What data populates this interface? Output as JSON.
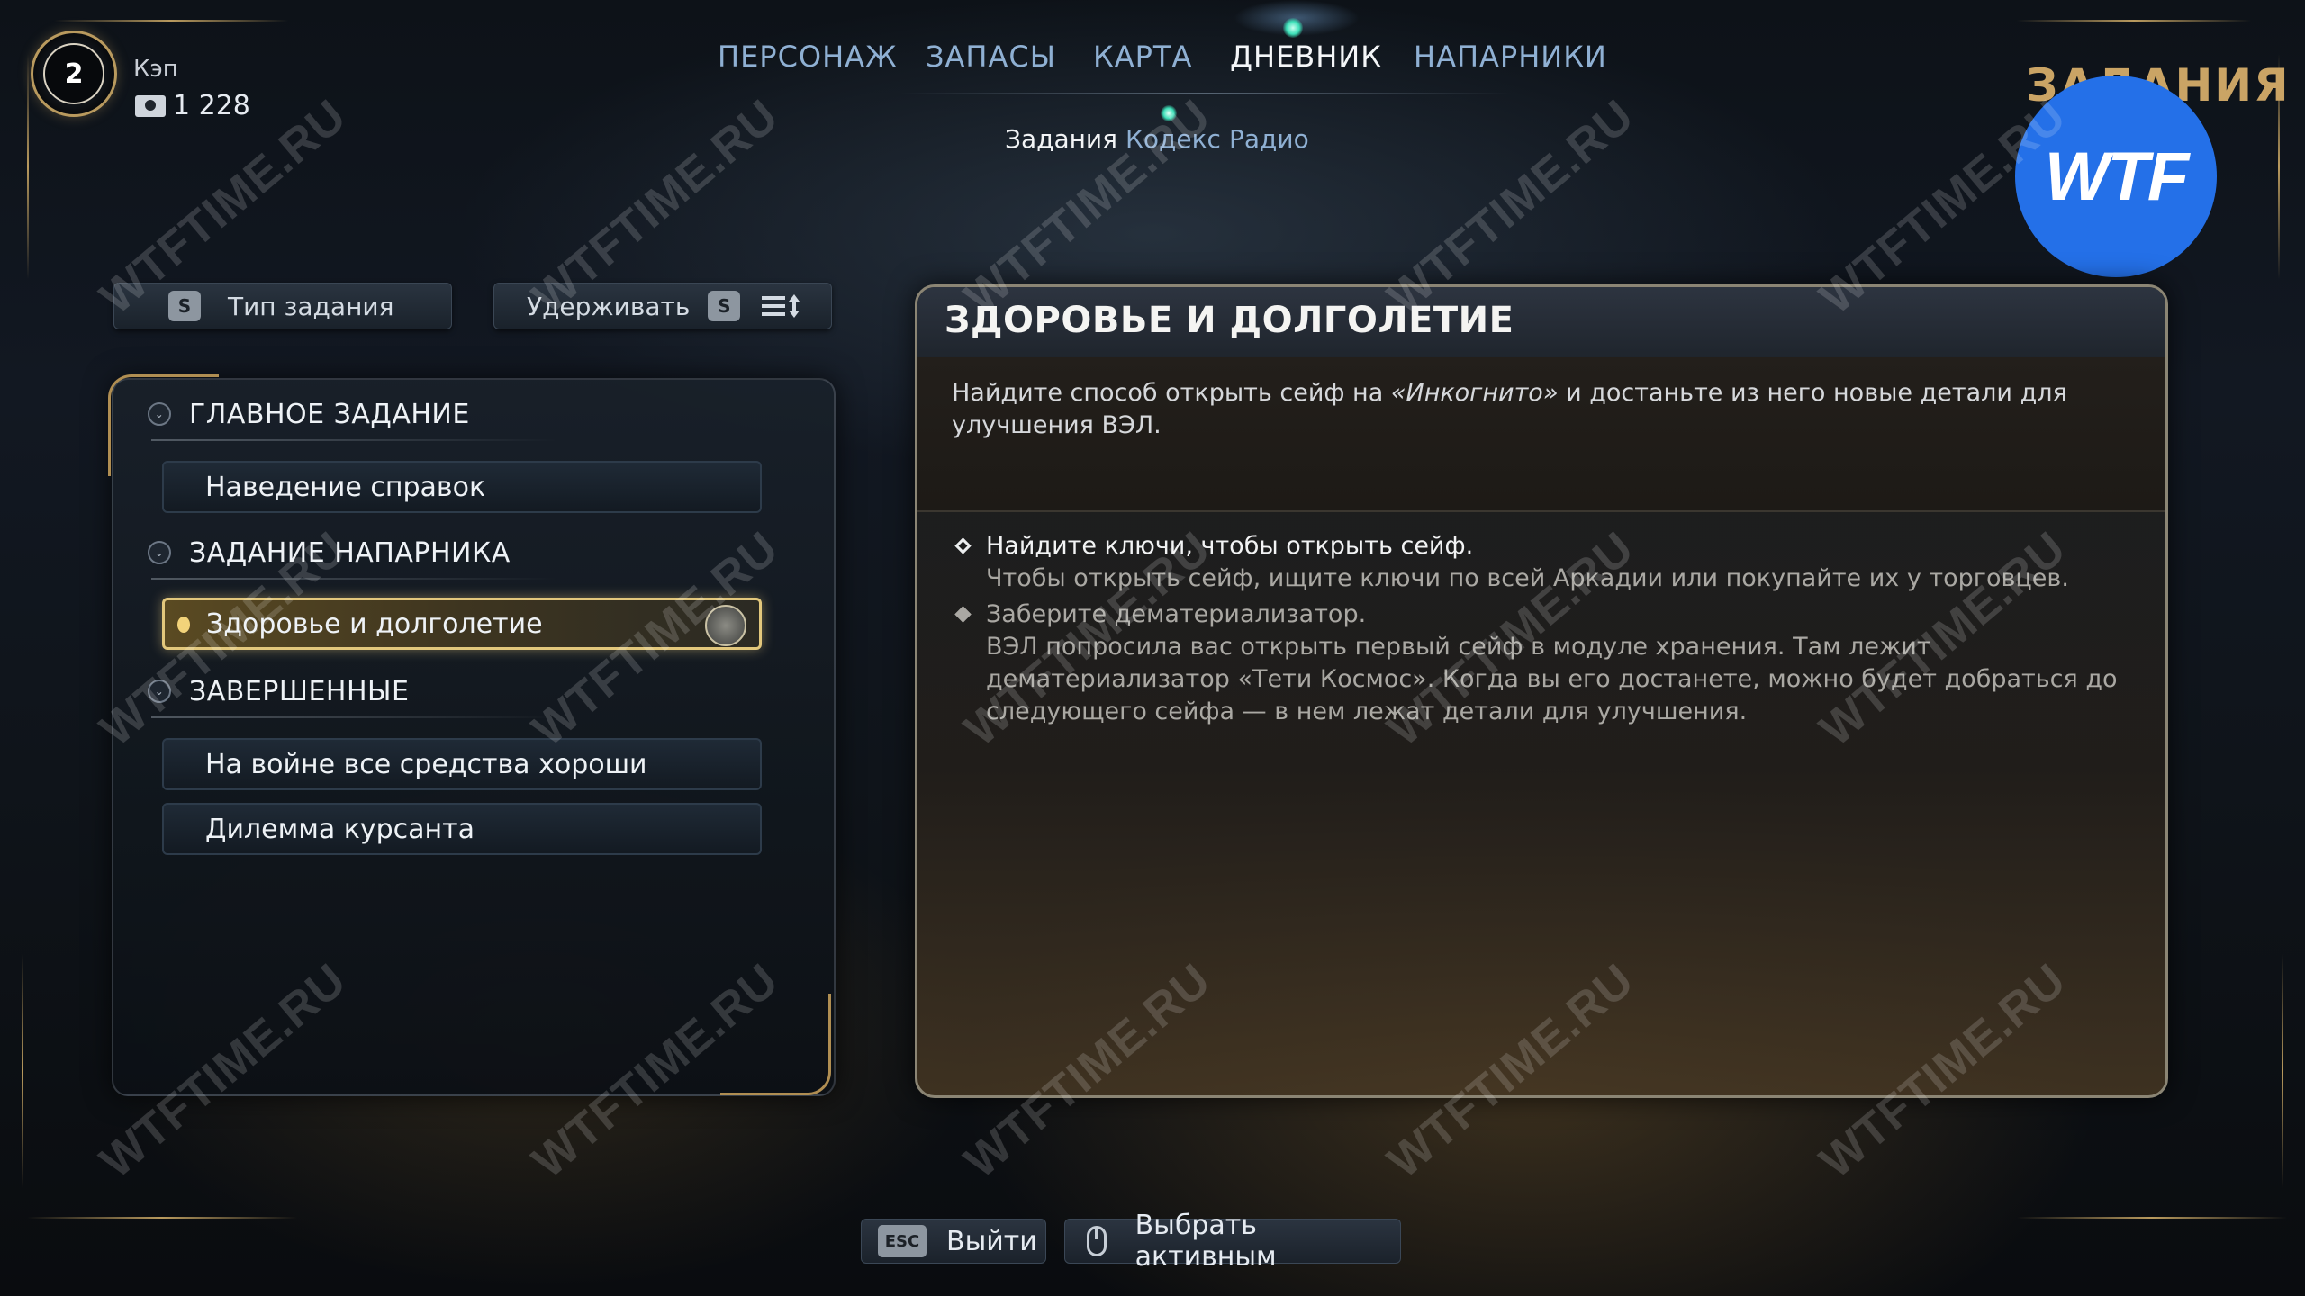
{
  "player": {
    "level": "2",
    "name": "Кэп",
    "money": "1 228"
  },
  "nav": {
    "tabs": [
      "ПЕРСОНАЖ",
      "ЗАПАСЫ",
      "КАРТА",
      "ДНЕВНИК",
      "НАПАРНИКИ"
    ],
    "active_tab": "ДНЕВНИК",
    "subtabs": [
      "Задания",
      "Кодекс",
      "Радио"
    ],
    "active_subtab": "Задания"
  },
  "section_title": "ЗАДАНИЯ",
  "brand_badge": "WTF",
  "filters": {
    "type_key": "S",
    "type_label": "Тип задания",
    "hold_label": "Удерживать",
    "hold_key": "S"
  },
  "quest_list": {
    "main_header": "ГЛАВНОЕ ЗАДАНИЕ",
    "main_items": [
      "Наведение справок"
    ],
    "companion_header": "ЗАДАНИЕ НАПАРНИКА",
    "companion_items": [
      "Здоровье и долголетие"
    ],
    "completed_header": "ЗАВЕРШЕННЫЕ",
    "completed_items": [
      "На войне все средства хороши",
      "Дилемма курсанта"
    ]
  },
  "detail": {
    "title": "ЗДОРОВЬЕ И ДОЛГОЛЕТИЕ",
    "description_before": "Найдите способ открыть сейф на ",
    "description_em": "«Инкогнито»",
    "description_after": " и достаньте из него новые детали для улучшения ВЭЛ.",
    "objectives": [
      {
        "title": "Найдите ключи, чтобы открыть сейф.",
        "text": "Чтобы открыть сейф, ищите ключи по всей Аркадии или покупайте их у торговцев.",
        "done": false
      },
      {
        "title": "Заберите дематериализатор.",
        "text": "ВЭЛ попросила вас открыть первый сейф в модуле хранения. Там лежит дематериализатор «Тети Космос». Когда вы его достанете, можно будет добраться до следующего сейфа — в нем лежат детали для улучшения.",
        "done": true
      }
    ]
  },
  "prompts": {
    "exit_key": "ESC",
    "exit_label": "Выйти",
    "select_label": "Выбрать активным"
  },
  "watermark": "WTFTIME.RU",
  "colors": {
    "accent_gold": "#caa465",
    "nav_blue": "#8fb0d3",
    "active_green": "#3ce0b8",
    "badge_blue": "#2470e8"
  }
}
